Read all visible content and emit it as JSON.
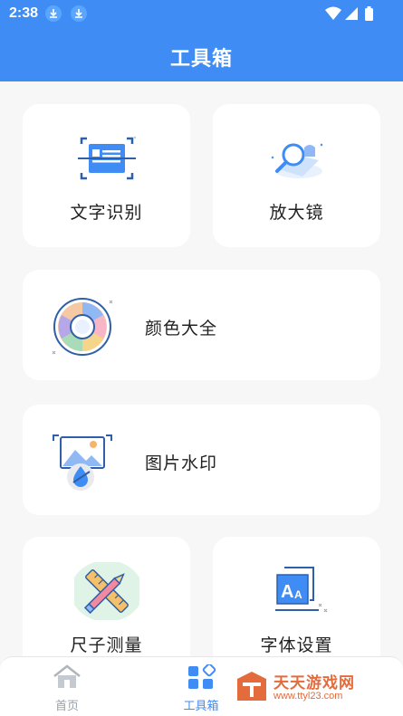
{
  "status_bar": {
    "time": "2:38"
  },
  "app_bar": {
    "title": "工具箱"
  },
  "tools": {
    "ocr": {
      "label": "文字识别",
      "icon": "text-recognition-icon"
    },
    "magnifier": {
      "label": "放大镜",
      "icon": "magnifier-icon"
    },
    "colors": {
      "label": "颜色大全",
      "icon": "color-wheel-icon"
    },
    "watermark": {
      "label": "图片水印",
      "icon": "image-watermark-icon"
    },
    "ruler": {
      "label": "尺子测量",
      "icon": "ruler-icon"
    },
    "font": {
      "label": "字体设置",
      "icon": "font-settings-icon"
    }
  },
  "bottom_nav": {
    "home": {
      "label": "首页",
      "icon": "home-icon"
    },
    "tools": {
      "label": "工具箱",
      "icon": "toolbox-icon",
      "selected": true
    }
  },
  "overlay_watermark": {
    "title": "天天游戏网",
    "url": "www.ttyl23.com"
  },
  "colors": {
    "primary": "#3f8cf4",
    "background": "#f7f7f7",
    "card": "#ffffff",
    "inactive": "#9aa0a8"
  }
}
